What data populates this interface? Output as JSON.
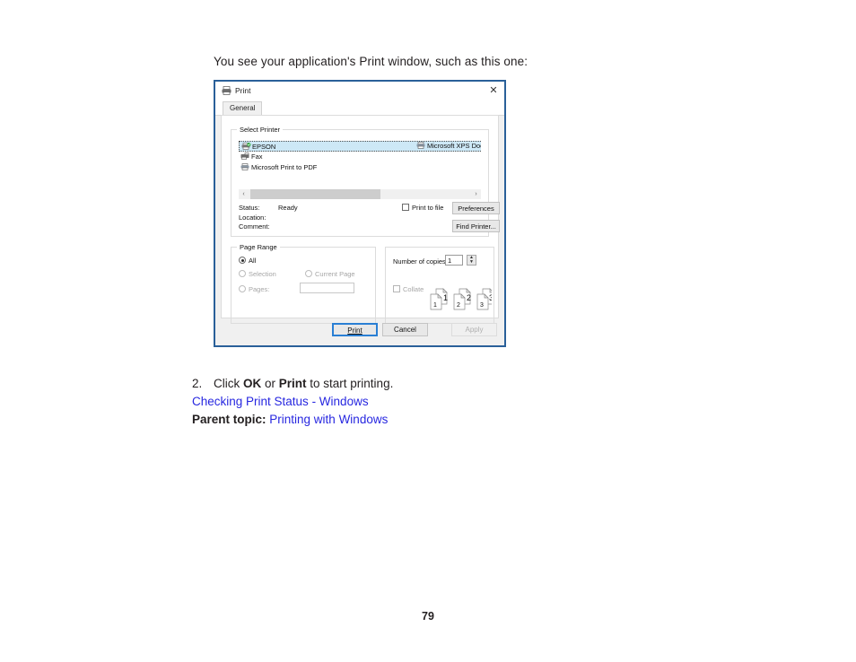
{
  "page": {
    "intro_text": "You see your application's Print window, such as this one:",
    "page_number": "79"
  },
  "steps": {
    "number": "2.",
    "text_before": "Click ",
    "bold_one": "OK",
    "text_middle": " or ",
    "bold_two": "Print",
    "text_after": " to start printing."
  },
  "links": {
    "checking_print_status": "Checking Print Status - Windows",
    "parent_topic_label": "Parent topic:",
    "parent_topic_link": "Printing with Windows"
  },
  "dialog": {
    "title": "Print",
    "title_icon": "printer-icon",
    "close_icon": "close-icon",
    "tab": "General",
    "select_printer": {
      "legend": "Select Printer",
      "printers": [
        {
          "name": "EPSON",
          "icon": "printer-default-icon",
          "selected": true
        },
        {
          "name": "Fax",
          "icon": "fax-icon",
          "selected": false
        },
        {
          "name": "Microsoft Print to PDF",
          "icon": "printer-icon",
          "selected": false
        }
      ],
      "second_column": {
        "name": "Microsoft XPS Documen",
        "icon": "printer-icon"
      },
      "scroll_left_icon": "chevron-left-icon",
      "scroll_right_icon": "chevron-right-icon",
      "status_label": "Status:",
      "status_value": "Ready",
      "location_label": "Location:",
      "location_value": "",
      "comment_label": "Comment:",
      "comment_value": "",
      "print_to_file_label": "Print to file",
      "print_to_file_checked": false,
      "preferences_button": "Preferences",
      "find_printer_button": "Find Printer..."
    },
    "page_range": {
      "legend": "Page Range",
      "options": [
        {
          "label": "All",
          "selected": true,
          "disabled": false
        },
        {
          "label": "Selection",
          "selected": false,
          "disabled": true
        },
        {
          "label": "Current Page",
          "selected": false,
          "disabled": true
        },
        {
          "label": "Pages:",
          "selected": false,
          "disabled": true
        }
      ],
      "pages_value": ""
    },
    "copies": {
      "number_of_copies_label": "Number of copies:",
      "number_of_copies_value": "1",
      "spinner_up_icon": "spinner-up-icon",
      "spinner_down_icon": "spinner-down-icon",
      "collate_label": "Collate",
      "collate_checked": false,
      "collate_disabled": true,
      "collate_art_numbers": [
        "1",
        "1",
        "2",
        "2",
        "3",
        "3"
      ]
    },
    "buttons": {
      "print": "Print",
      "cancel": "Cancel",
      "apply": "Apply",
      "apply_disabled": true,
      "print_focused": true
    }
  },
  "colors": {
    "link": "#2727e0",
    "text": "#231f20",
    "dialog_border": "#2a6099",
    "selection_highlight": "#cde8f6",
    "focus_border": "#2a7fd4"
  }
}
